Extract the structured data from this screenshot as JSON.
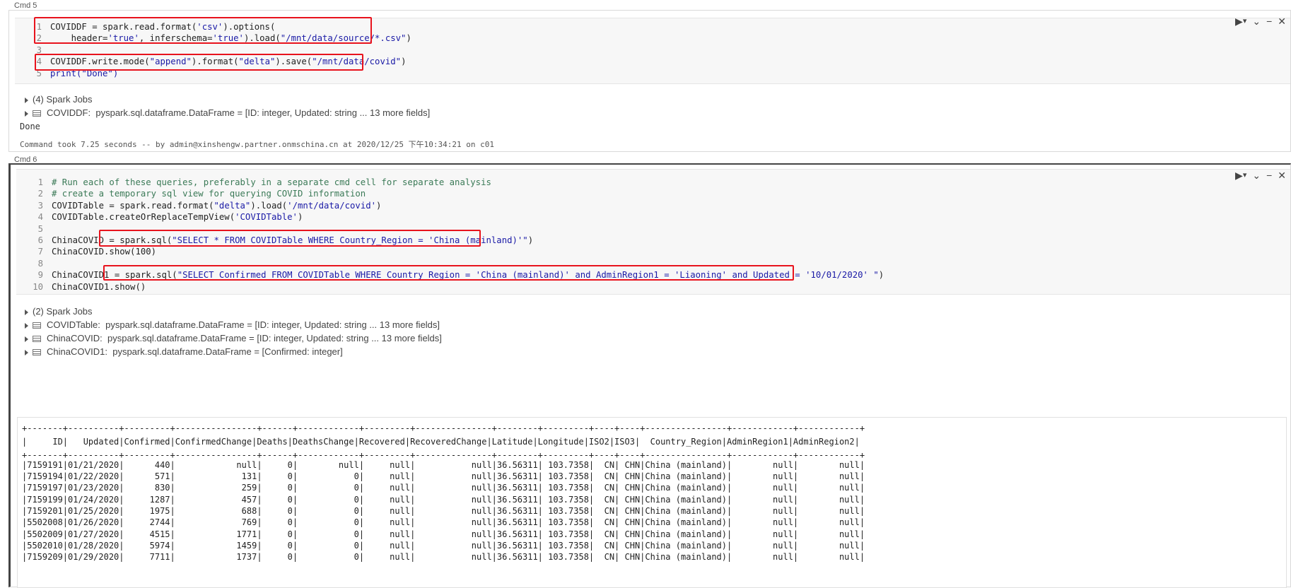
{
  "cmd5": {
    "label": "Cmd 5",
    "lines": [
      {
        "n": "1",
        "html": "COVIDDF = spark.read.format(<span class=\"str\">'csv'</span>).options("
      },
      {
        "n": "2",
        "html": "    header=<span class=\"str\">'true'</span>, inferschema=<span class=\"str\">'true'</span>).load(<span class=\"str\">\"/mnt/data/source/*.csv\"</span>)"
      },
      {
        "n": "3",
        "html": ""
      },
      {
        "n": "4",
        "html": "COVIDDF.write.mode(<span class=\"str\">\"append\"</span>).format(<span class=\"str\">\"delta\"</span>).save(<span class=\"str\">\"/mnt/data/covid\"</span>)"
      },
      {
        "n": "5",
        "html": "<span class=\"str\">print(\"Done\")</span>"
      }
    ],
    "spark_jobs": "(4) Spark Jobs",
    "dataframe_name": "COVIDDF:",
    "dataframe_type": "pyspark.sql.dataframe.DataFrame = [ID: integer, Updated: string ... 13 more fields]",
    "output": "Done",
    "took": "Command took 7.25 seconds -- by admin@xinshengw.partner.onmschina.cn at 2020/12/25 下午10:34:21 on c01"
  },
  "cmd6": {
    "label": "Cmd 6",
    "lines": [
      {
        "n": "1",
        "html": "<span class=\"cmt\"># Run each of these queries, preferably in a separate cmd cell for separate analysis</span>"
      },
      {
        "n": "2",
        "html": "<span class=\"cmt\"># create a temporary sql view for querying COVID information</span>"
      },
      {
        "n": "3",
        "html": "COVIDTable = spark.read.format(<span class=\"str\">\"delta\"</span>).load(<span class=\"str\">'/mnt/data/covid'</span>)"
      },
      {
        "n": "4",
        "html": "COVIDTable.createOrReplaceTempView(<span class=\"str\">'COVIDTable'</span>)"
      },
      {
        "n": "5",
        "html": ""
      },
      {
        "n": "6",
        "html": "ChinaCOVID = spark.sql(<span class=\"str\">\"SELECT * FROM COVIDTable WHERE Country_Region = 'China (mainland)'\"</span>)"
      },
      {
        "n": "7",
        "html": "ChinaCOVID.show(100)"
      },
      {
        "n": "8",
        "html": ""
      },
      {
        "n": "9",
        "html": "ChinaCOVID1 = spark.sql(<span class=\"str\">\"SELECT Confirmed FROM COVIDTable WHERE Country_Region = 'China (mainland)' and AdminRegion1 = 'Liaoning' and Updated = '10/01/2020' \"</span>)"
      },
      {
        "n": "10",
        "html": "ChinaCOVID1.show()"
      }
    ],
    "spark_jobs": "(2) Spark Jobs",
    "dataframes": [
      {
        "name": "COVIDTable:",
        "type": "pyspark.sql.dataframe.DataFrame = [ID: integer, Updated: string ... 13 more fields]"
      },
      {
        "name": "ChinaCOVID:",
        "type": "pyspark.sql.dataframe.DataFrame = [ID: integer, Updated: string ... 13 more fields]"
      },
      {
        "name": "ChinaCOVID1:",
        "type": "pyspark.sql.dataframe.DataFrame = [Confirmed: integer]"
      }
    ],
    "table_lines": [
      "+-------+----------+---------+----------------+------+------------+---------+---------------+--------+---------+----+----+----------------+------------+------------+",
      "|     ID|   Updated|Confirmed|ConfirmedChange|Deaths|DeathsChange|Recovered|RecoveredChange|Latitude|Longitude|ISO2|ISO3|  Country_Region|AdminRegion1|AdminRegion2|",
      "+-------+----------+---------+----------------+------+------------+---------+---------------+--------+---------+----+----+----------------+------------+------------+",
      "|7159191|01/21/2020|      440|            null|     0|        null|     null|           null|36.56311| 103.7358|  CN| CHN|China (mainland)|        null|        null|",
      "|7159194|01/22/2020|      571|             131|     0|           0|     null|           null|36.56311| 103.7358|  CN| CHN|China (mainland)|        null|        null|",
      "|7159197|01/23/2020|      830|             259|     0|           0|     null|           null|36.56311| 103.7358|  CN| CHN|China (mainland)|        null|        null|",
      "|7159199|01/24/2020|     1287|             457|     0|           0|     null|           null|36.56311| 103.7358|  CN| CHN|China (mainland)|        null|        null|",
      "|7159201|01/25/2020|     1975|             688|     0|           0|     null|           null|36.56311| 103.7358|  CN| CHN|China (mainland)|        null|        null|",
      "|5502008|01/26/2020|     2744|             769|     0|           0|     null|           null|36.56311| 103.7358|  CN| CHN|China (mainland)|        null|        null|",
      "|5502009|01/27/2020|     4515|            1771|     0|           0|     null|           null|36.56311| 103.7358|  CN| CHN|China (mainland)|        null|        null|",
      "|5502010|01/28/2020|     5974|            1459|     0|           0|     null|           null|36.56311| 103.7358|  CN| CHN|China (mainland)|        null|        null|",
      "|7159209|01/29/2020|     7711|            1737|     0|           0|     null|           null|36.56311| 103.7358|  CN| CHN|China (mainland)|        null|        null|"
    ]
  },
  "toolbar": {
    "run": "▶",
    "run_caret": "▾",
    "collapse": "⌄",
    "minimize": "−",
    "close": "✕"
  }
}
